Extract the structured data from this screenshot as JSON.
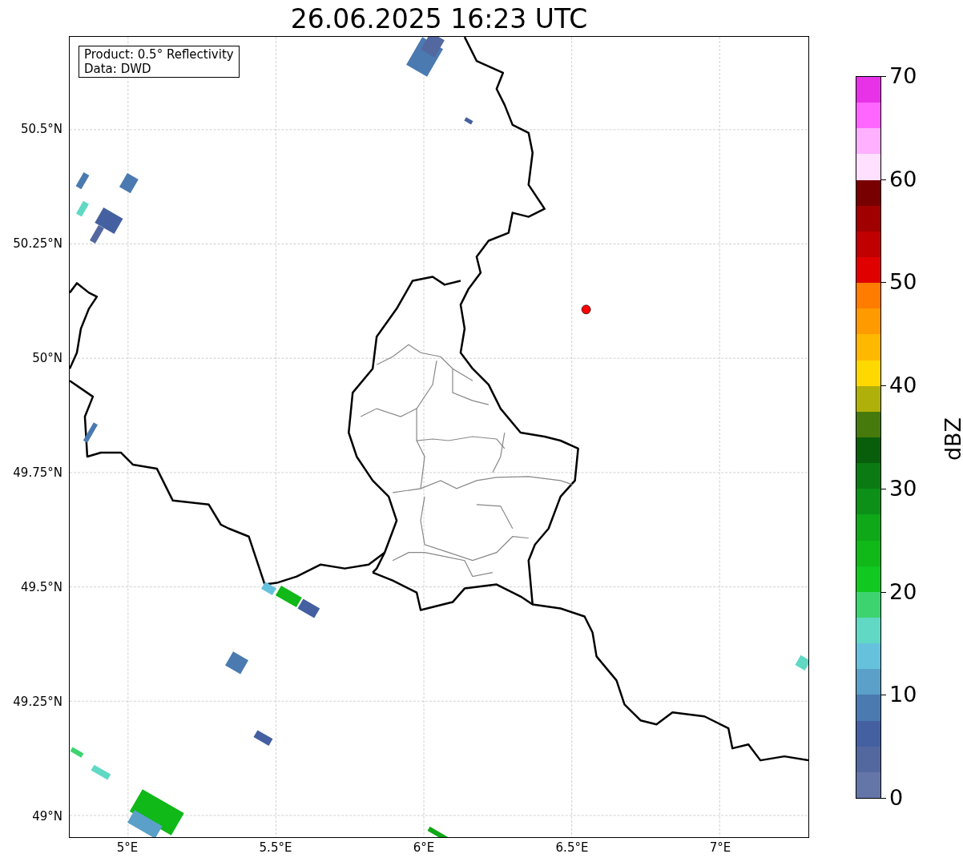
{
  "title": "26.06.2025 16:23 UTC",
  "legend": {
    "lines": [
      "Product: 0.5° Reflectivity",
      "Data: DWD"
    ]
  },
  "map": {
    "lat_ticks": [
      "50.5°N",
      "50.25°N",
      "50°N",
      "49.75°N",
      "49.5°N",
      "49.25°N",
      "49°N"
    ],
    "lon_ticks": [
      "5°E",
      "5.5°E",
      "6°E",
      "6.5°E",
      "7°E"
    ]
  },
  "colorbar": {
    "label": "dBZ",
    "ticks": [
      "70",
      "60",
      "50",
      "40",
      "30",
      "20",
      "10",
      "0"
    ],
    "bins": [
      {
        "color": "#e832e8"
      },
      {
        "color": "#ff66ff"
      },
      {
        "color": "#ffb0ff"
      },
      {
        "color": "#ffe0ff"
      },
      {
        "color": "#780000"
      },
      {
        "color": "#a00000"
      },
      {
        "color": "#c00000"
      },
      {
        "color": "#e00000"
      },
      {
        "color": "#ff7c00"
      },
      {
        "color": "#ff9a00"
      },
      {
        "color": "#ffb800"
      },
      {
        "color": "#ffd800"
      },
      {
        "color": "#b0b00a"
      },
      {
        "color": "#467a0c"
      },
      {
        "color": "#095e0c"
      },
      {
        "color": "#0b7a12"
      },
      {
        "color": "#0c9018"
      },
      {
        "color": "#0ea818"
      },
      {
        "color": "#10b818"
      },
      {
        "color": "#10c820"
      },
      {
        "color": "#3dd470"
      },
      {
        "color": "#60d8c4"
      },
      {
        "color": "#66c2dc"
      },
      {
        "color": "#5aa0c8"
      },
      {
        "color": "#4a7ab0"
      },
      {
        "color": "#4460a0"
      },
      {
        "color": "#5468a0"
      },
      {
        "color": "#6475a8"
      }
    ]
  }
}
